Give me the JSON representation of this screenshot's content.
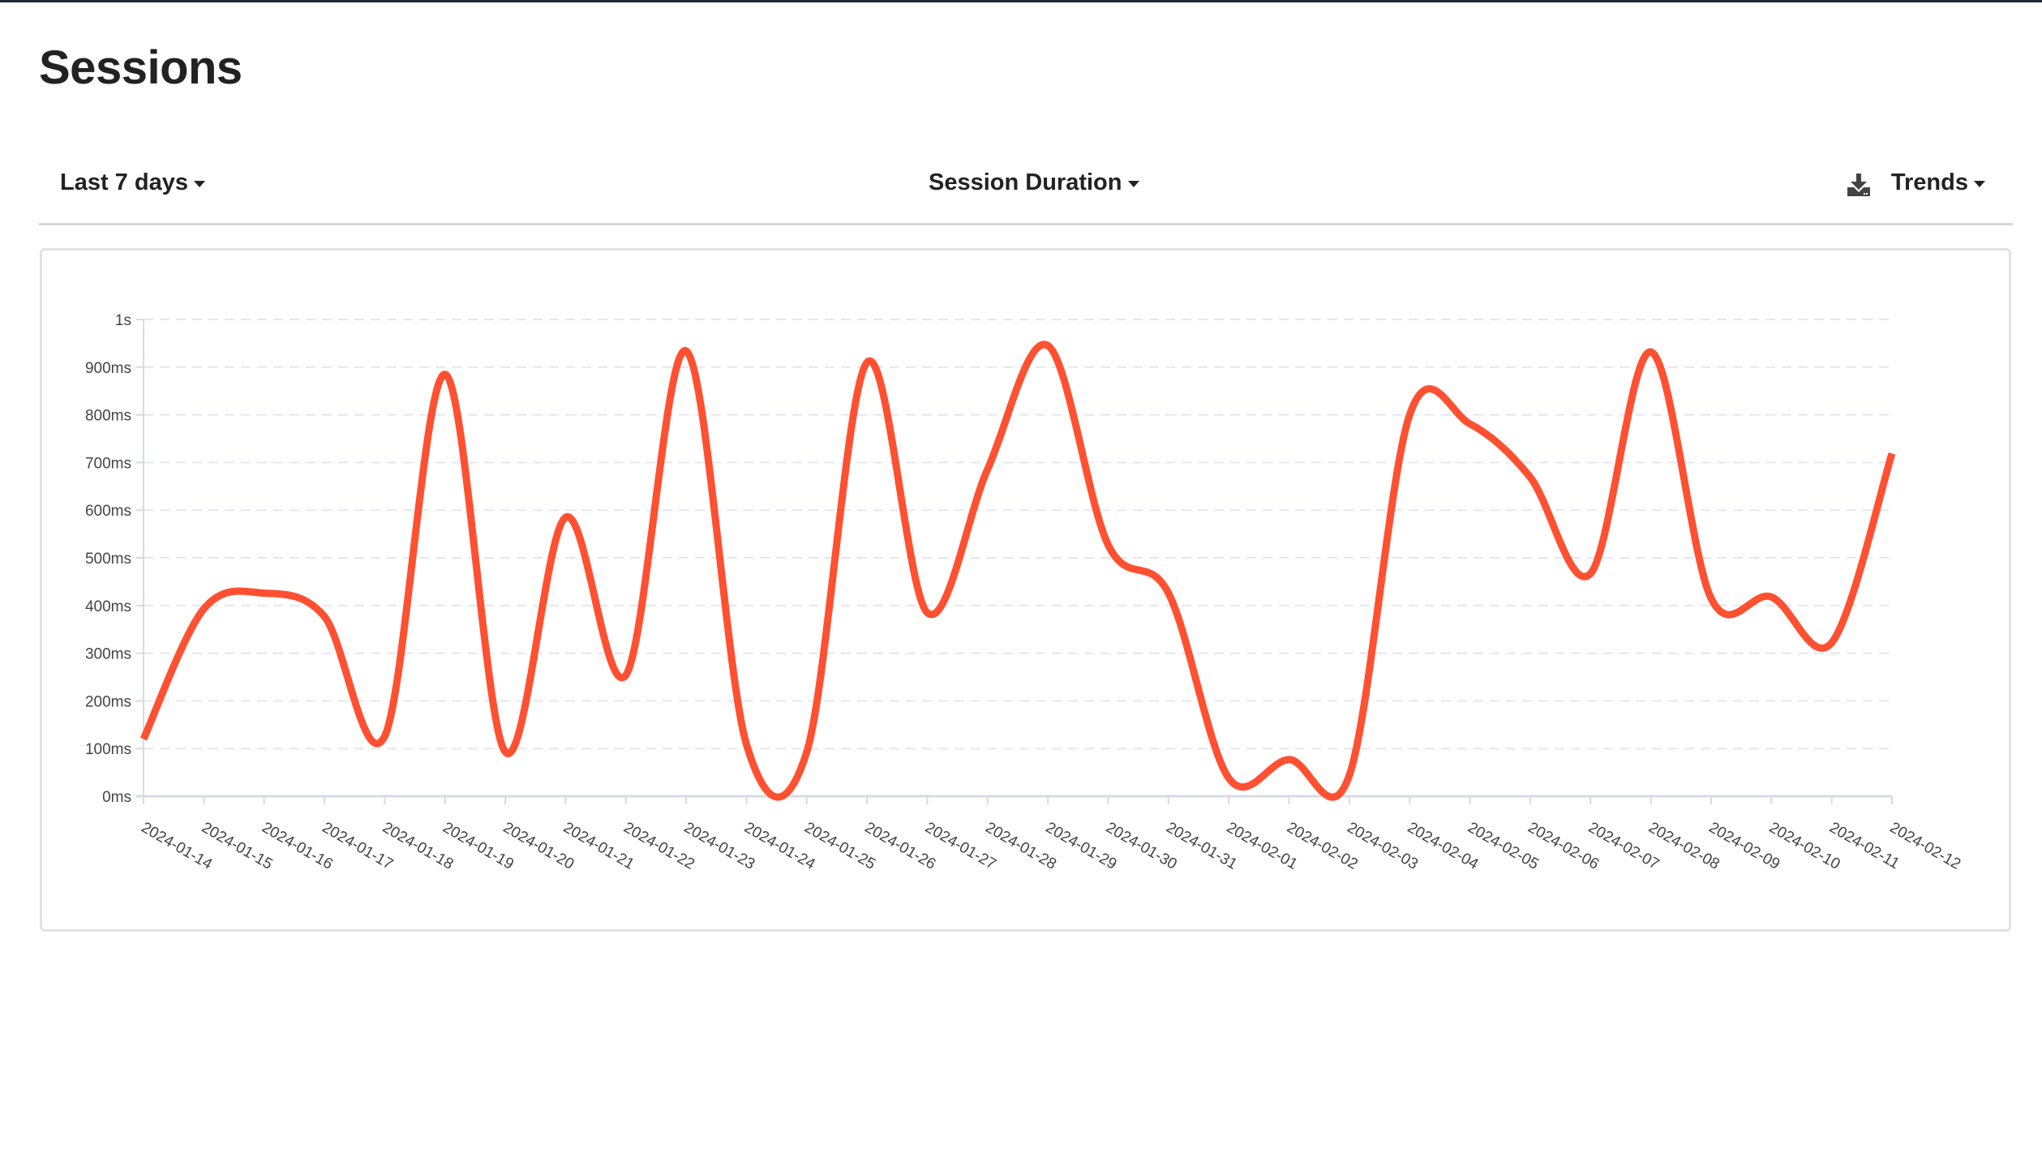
{
  "page": {
    "title": "Sessions"
  },
  "toolbar": {
    "range_label": "Last 7 days",
    "metric_label": "Session Duration",
    "trends_label": "Trends",
    "download_icon": "download-icon"
  },
  "colors": {
    "line": "#ff5032",
    "grid": "#e3e7ee",
    "axis": "#d5dbe5",
    "text": "#444444",
    "topbar": "#1f2a3c"
  },
  "chart_data": {
    "type": "line",
    "title": "",
    "xlabel": "",
    "ylabel": "Session Duration",
    "ylim": [
      0,
      1000
    ],
    "y_unit": "ms",
    "yticks": [
      0,
      100,
      200,
      300,
      400,
      500,
      600,
      700,
      800,
      900,
      1000
    ],
    "ytick_labels": [
      "0ms",
      "100ms",
      "200ms",
      "300ms",
      "400ms",
      "500ms",
      "600ms",
      "700ms",
      "800ms",
      "900ms",
      "1s"
    ],
    "grid": true,
    "legend": "none",
    "smooth": true,
    "x": [
      "2024-01-14",
      "2024-01-15",
      "2024-01-16",
      "2024-01-17",
      "2024-01-18",
      "2024-01-19",
      "2024-01-20",
      "2024-01-21",
      "2024-01-22",
      "2024-01-23",
      "2024-01-24",
      "2024-01-25",
      "2024-01-26",
      "2024-01-27",
      "2024-01-28",
      "2024-01-29",
      "2024-01-30",
      "2024-01-31",
      "2024-02-01",
      "2024-02-02",
      "2024-02-03",
      "2024-02-04",
      "2024-02-05",
      "2024-02-06",
      "2024-02-07",
      "2024-02-08",
      "2024-02-09",
      "2024-02-10",
      "2024-02-11",
      "2024-02-12"
    ],
    "series": [
      {
        "name": "Session Duration",
        "values": [
          120,
          393,
          426,
          377,
          126,
          885,
          93,
          585,
          254,
          934,
          109,
          93,
          910,
          385,
          686,
          945,
          527,
          426,
          38,
          77,
          44,
          800,
          781,
          669,
          467,
          932,
          415,
          418,
          322,
          719
        ]
      }
    ]
  }
}
